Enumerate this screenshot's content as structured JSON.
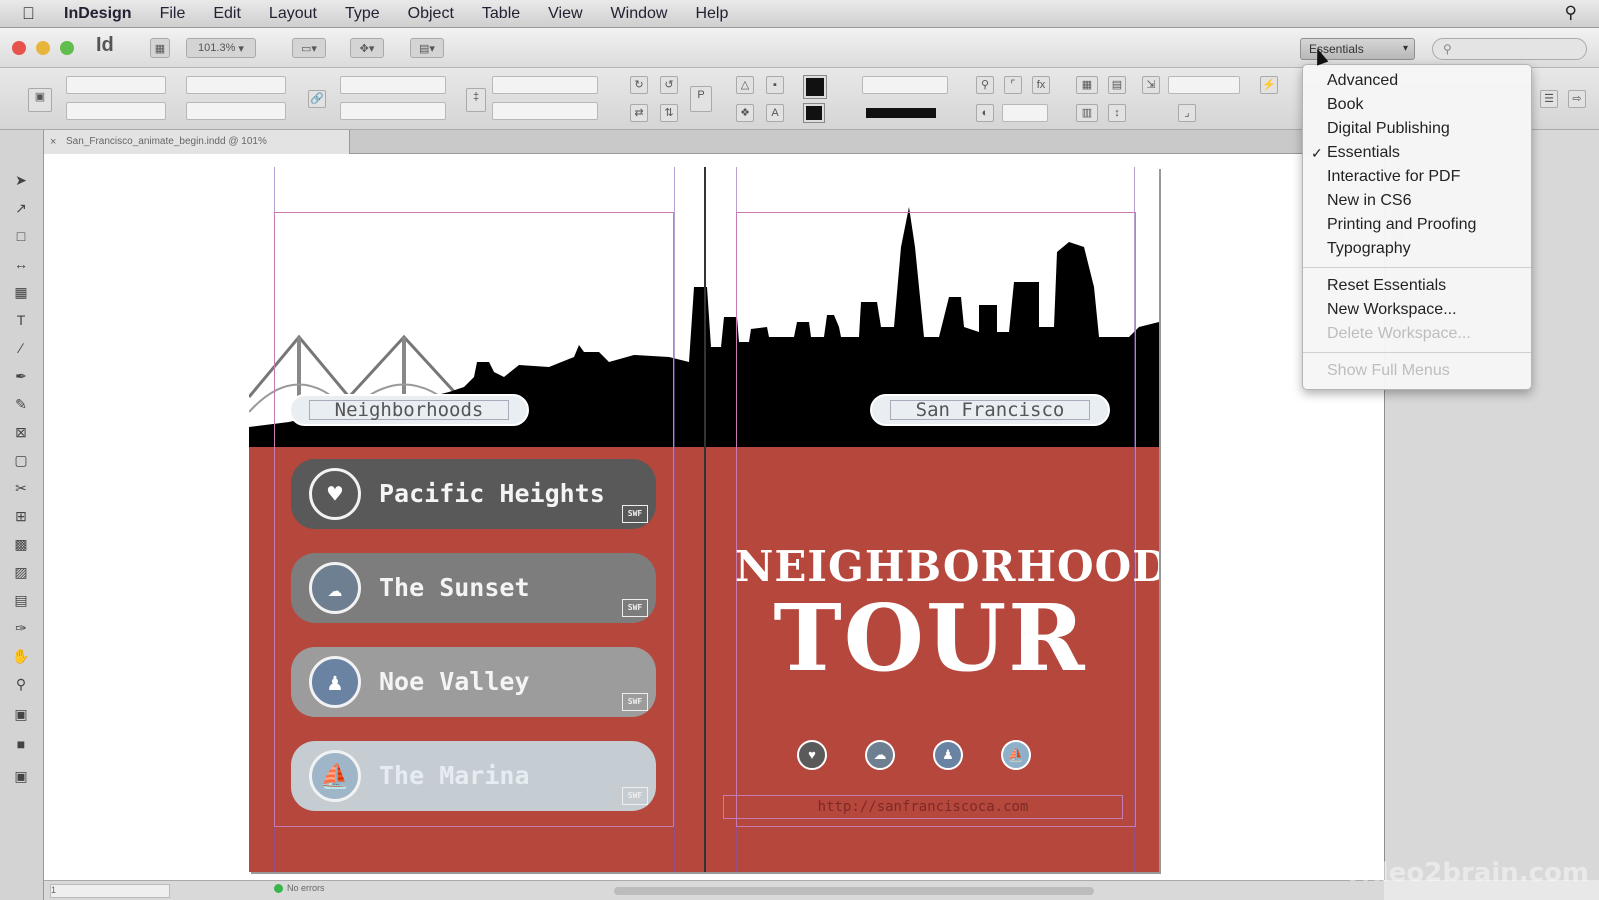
{
  "menubar": {
    "app_name": "InDesign",
    "items": [
      "File",
      "Edit",
      "Layout",
      "Type",
      "Object",
      "Table",
      "View",
      "Window",
      "Help"
    ]
  },
  "appbar": {
    "logo": "Id",
    "zoom": "101.3%",
    "workspace_label": "Essentials",
    "search_placeholder": ""
  },
  "document": {
    "tab_title": "San_Francisco_animate_begin.indd @ 101%"
  },
  "workspace_menu": {
    "items": [
      {
        "label": "Advanced",
        "checked": false,
        "enabled": true
      },
      {
        "label": "Book",
        "checked": false,
        "enabled": true
      },
      {
        "label": "Digital Publishing",
        "checked": false,
        "enabled": true
      },
      {
        "label": "Essentials",
        "checked": true,
        "enabled": true
      },
      {
        "label": "Interactive for PDF",
        "checked": false,
        "enabled": true
      },
      {
        "label": "New in CS6",
        "checked": false,
        "enabled": true
      },
      {
        "label": "Printing and Proofing",
        "checked": false,
        "enabled": true
      },
      {
        "label": "Typography",
        "checked": false,
        "enabled": true
      }
    ],
    "actions": [
      {
        "label": "Reset Essentials",
        "enabled": true
      },
      {
        "label": "New Workspace...",
        "enabled": true
      },
      {
        "label": "Delete Workspace...",
        "enabled": false
      }
    ],
    "show_full_menus": {
      "label": "Show Full Menus",
      "enabled": false
    }
  },
  "spread": {
    "left_label": "Neighborhoods",
    "right_label": "San Francisco",
    "neighborhoods": [
      {
        "name": "Pacific Heights",
        "icon": "heart-icon"
      },
      {
        "name": "The Sunset",
        "icon": "cloud-icon"
      },
      {
        "name": "Noe Valley",
        "icon": "people-icon"
      },
      {
        "name": "The Marina",
        "icon": "boat-icon"
      }
    ],
    "badge": "SWF",
    "title_line1": "NEIGHBORHOOD",
    "title_line2": "TOUR",
    "url": "http://sanfranciscoca.com",
    "colors": {
      "red": "#b5473d",
      "sky": "#ffffff",
      "skyline": "#000000"
    }
  },
  "statusbar": {
    "page": "1",
    "errors": "No errors"
  },
  "watermark": "video2brain.com"
}
